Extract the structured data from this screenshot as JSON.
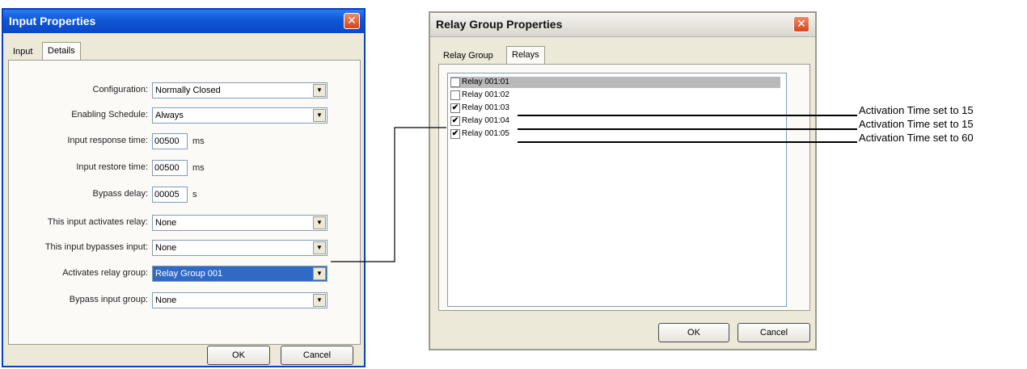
{
  "input_dialog": {
    "title": "Input Properties",
    "close_glyph": "✕",
    "tabs": [
      {
        "label": "Input"
      },
      {
        "label": "Details"
      }
    ],
    "fields": {
      "configuration": {
        "label": "Configuration:",
        "value": "Normally Closed"
      },
      "enabling_schedule": {
        "label": "Enabling Schedule:",
        "value": "Always"
      },
      "input_response_time": {
        "label": "Input response time:",
        "value": "00500",
        "unit": "ms"
      },
      "input_restore_time": {
        "label": "Input restore time:",
        "value": "00500",
        "unit": "ms"
      },
      "bypass_delay": {
        "label": "Bypass delay:",
        "value": "00005",
        "unit": "s"
      },
      "activates_relay": {
        "label": "This input activates relay:",
        "value": "None"
      },
      "bypasses_input": {
        "label": "This input bypasses input:",
        "value": "None"
      },
      "activates_relay_group": {
        "label": "Activates relay group:",
        "value": "Relay Group 001"
      },
      "bypass_input_group": {
        "label": "Bypass input group:",
        "value": "None"
      }
    },
    "ok_label": "OK",
    "cancel_label": "Cancel"
  },
  "relay_dialog": {
    "title": "Relay Group Properties",
    "close_glyph": "✕",
    "tabs": [
      {
        "label": "Relay Group"
      },
      {
        "label": "Relays"
      }
    ],
    "relays": [
      {
        "label": "Relay 001:01",
        "checked": false,
        "selected": true
      },
      {
        "label": "Relay 001:02",
        "checked": false,
        "selected": false
      },
      {
        "label": "Relay 001:03",
        "checked": true,
        "selected": false
      },
      {
        "label": "Relay 001:04",
        "checked": true,
        "selected": false
      },
      {
        "label": "Relay 001:05",
        "checked": true,
        "selected": false
      }
    ],
    "ok_label": "OK",
    "cancel_label": "Cancel"
  },
  "check_glyph": "✔",
  "dropdown_glyph": "▼",
  "callouts": [
    {
      "text": "Activation Time set to 15"
    },
    {
      "text": "Activation Time set to 15"
    },
    {
      "text": "Activation Time set to 60"
    }
  ]
}
